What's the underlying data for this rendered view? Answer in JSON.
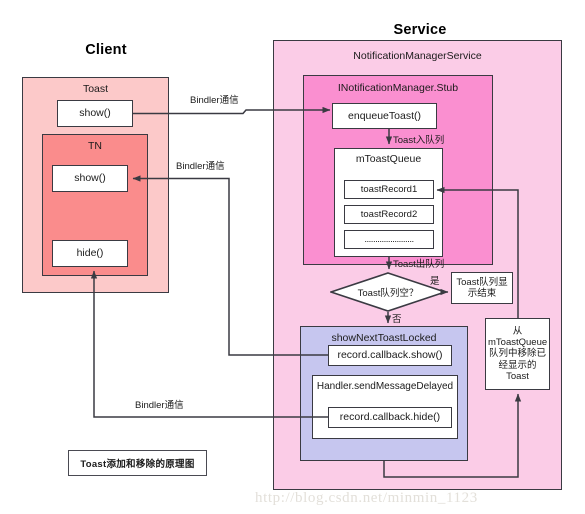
{
  "titles": {
    "client": "Client",
    "service": "Service"
  },
  "client": {
    "toast_label": "Toast",
    "toast_show": "show()",
    "tn_label": "TN",
    "tn_show": "show()",
    "tn_hide": "hide()"
  },
  "service": {
    "nms_label": "NotificationManagerService",
    "stub_label": "INotificationManager.Stub",
    "enqueue_toast": "enqueueToast()",
    "queue_label": "mToastQueue",
    "records": [
      "toastRecord1",
      "toastRecord2",
      "......................."
    ],
    "decision": "Toast队列空？",
    "decision_yes": "是",
    "decision_no": "否",
    "end_box": "Toast队列显示结束",
    "next_locked_label": "showNextToastLocked",
    "callback_show": "record.callback.show()",
    "handler_label": "Handler.sendMessageDelayed",
    "callback_hide": "record.callback.hide()",
    "remove_box": "从mToastQueue队列中移除已经显示的Toast"
  },
  "edges": {
    "binder_1": "Bindler通信",
    "binder_2": "Bindler通信",
    "binder_3": "Bindler通信",
    "enqueue": "Toast入队列",
    "dequeue": "Toast出队列"
  },
  "legend": {
    "caption": "Toast添加和移除的原理图"
  },
  "watermark": {
    "url": "http://blog.csdn.net/minmin_1123"
  },
  "colors": {
    "client_outer": "#fcc9c9",
    "client_tn": "#fa8c8c",
    "service_outer": "#fbcce7",
    "service_stub": "#fa8fd0",
    "next_locked": "#c6c6ef",
    "stroke": "#3a3a42",
    "white": "#ffffff"
  }
}
